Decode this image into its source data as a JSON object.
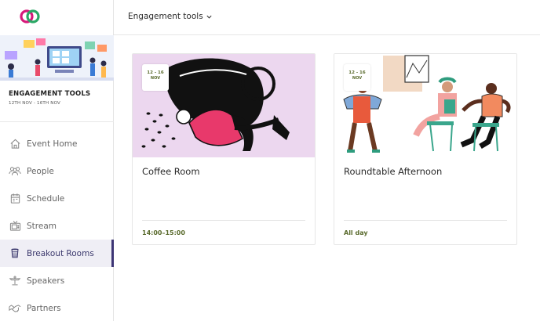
{
  "header": {
    "dropdown_label": "Engagement tools"
  },
  "event": {
    "title": "ENGAGEMENT TOOLS",
    "dates": "12TH NOV - 16TH NOV"
  },
  "sidebar": {
    "items": [
      {
        "label": "Event Home",
        "icon": "home-icon"
      },
      {
        "label": "People",
        "icon": "people-icon"
      },
      {
        "label": "Schedule",
        "icon": "schedule-icon"
      },
      {
        "label": "Stream",
        "icon": "stream-icon"
      },
      {
        "label": "Breakout Rooms",
        "icon": "breakout-rooms-icon",
        "active": true
      },
      {
        "label": "Speakers",
        "icon": "speakers-icon"
      },
      {
        "label": "Partners",
        "icon": "partners-icon"
      }
    ]
  },
  "cards": [
    {
      "title": "Coffee Room",
      "date_range": "12 - 16",
      "date_month": "NOV",
      "time": "14:00–15:00",
      "image_bg": "#ecd7ef"
    },
    {
      "title": "Roundtable Afternoon",
      "date_range": "12 - 16",
      "date_month": "NOV",
      "time": "All day",
      "image_bg": "#ffffff"
    }
  ],
  "colors": {
    "accent": "#3d3575",
    "active_bg": "#efeef5",
    "date_text": "#5a6b2d",
    "logo_pink": "#d6197a",
    "logo_green": "#2aa865"
  }
}
